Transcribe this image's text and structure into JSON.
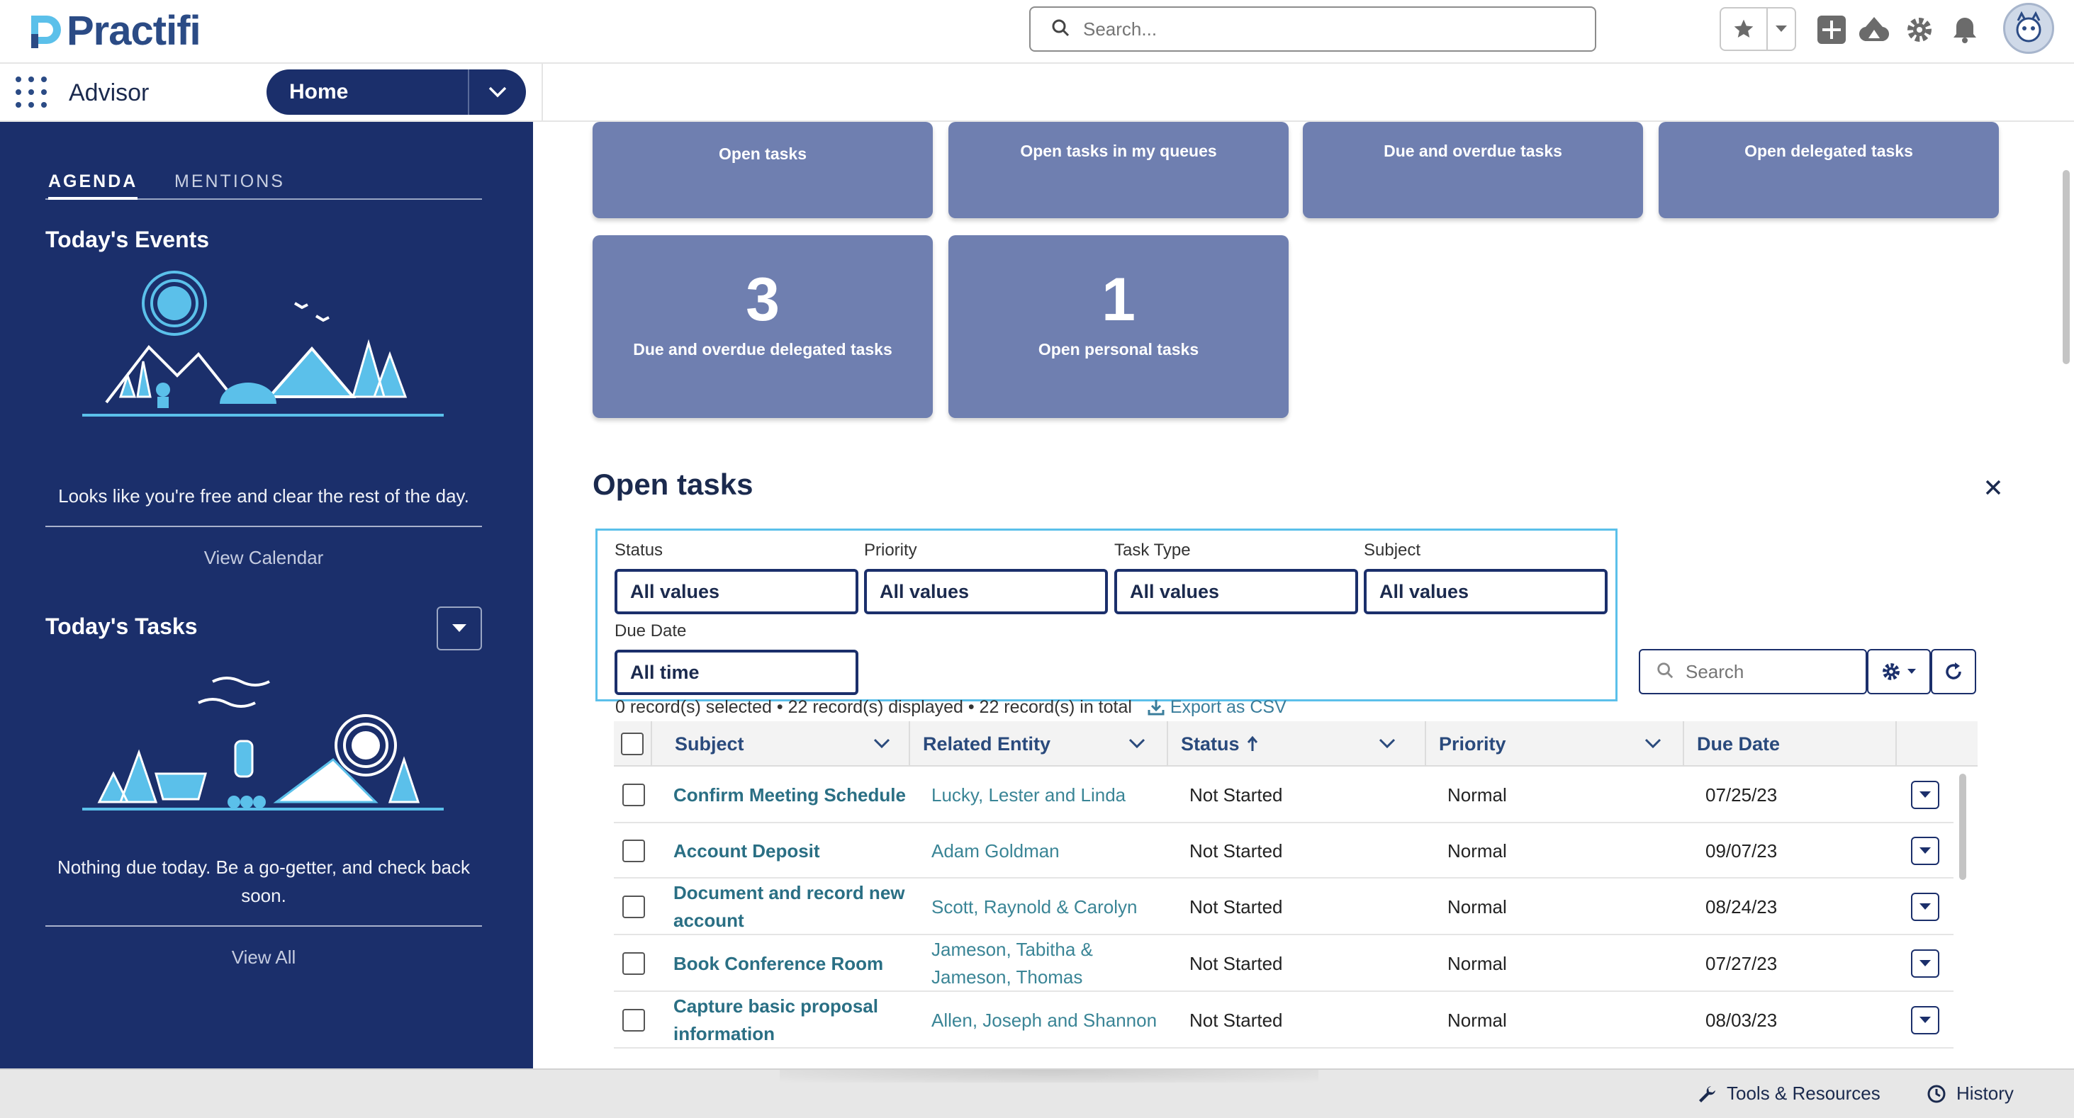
{
  "brand": {
    "logo_text": "Practifi",
    "accent": "#1b2f6b",
    "logo_color": "#2b4b85",
    "link_color": "#2a6f84"
  },
  "header": {
    "search_placeholder": "Search...",
    "icons": [
      "star-icon",
      "chevron-down-icon",
      "add-icon",
      "trailhead-icon",
      "gear-icon",
      "bell-icon",
      "avatar"
    ]
  },
  "nav": {
    "app_name": "Advisor",
    "tab_label": "Home"
  },
  "sidebar": {
    "tabs": [
      "AGENDA",
      "MENTIONS"
    ],
    "events_title": "Today's Events",
    "events_message": "Looks like you're free and clear the rest of the day.",
    "events_link": "View Calendar",
    "tasks_title": "Today's Tasks",
    "tasks_message": "Nothing due today. Be a go-getter, and check back soon.",
    "tasks_link": "View All"
  },
  "tiles": [
    {
      "label": "Open tasks",
      "count": ""
    },
    {
      "label": "Open tasks in my queues",
      "count": ""
    },
    {
      "label": "Due and overdue tasks",
      "count": ""
    },
    {
      "label": "Open delegated tasks",
      "count": ""
    },
    {
      "label": "Due and overdue delegated tasks",
      "count": "3"
    },
    {
      "label": "Open personal tasks",
      "count": "1"
    }
  ],
  "open_tasks": {
    "title": "Open tasks",
    "filters": {
      "status_label": "Status",
      "status_value": "All values",
      "priority_label": "Priority",
      "priority_value": "All values",
      "type_label": "Task Type",
      "type_value": "All values",
      "subject_label": "Subject",
      "subject_value": "All values",
      "due_label": "Due Date",
      "due_value": "All time"
    },
    "search_placeholder": "Search",
    "record_info": "0 record(s) selected • 22 record(s) displayed • 22 record(s) in total",
    "export_label": "Export as CSV",
    "columns": [
      "Subject",
      "Related Entity",
      "Status",
      "Priority",
      "Due Date"
    ],
    "rows": [
      {
        "subject": "Confirm Meeting Schedule",
        "related": "Lucky, Lester and Linda",
        "status": "Not Started",
        "priority": "Normal",
        "due": "07/25/23"
      },
      {
        "subject": "Account Deposit",
        "related": "Adam Goldman",
        "status": "Not Started",
        "priority": "Normal",
        "due": "09/07/23"
      },
      {
        "subject": "Document and record new account",
        "related": "Scott, Raynold & Carolyn",
        "status": "Not Started",
        "priority": "Normal",
        "due": "08/24/23"
      },
      {
        "subject": "Book Conference Room",
        "related": "Jameson, Tabitha & Jameson, Thomas",
        "status": "Not Started",
        "priority": "Normal",
        "due": "07/27/23"
      },
      {
        "subject": "Capture basic proposal information",
        "related": "Allen, Joseph and Shannon",
        "status": "Not Started",
        "priority": "Normal",
        "due": "08/03/23"
      }
    ]
  },
  "footer": {
    "tools_label": "Tools & Resources",
    "history_label": "History"
  }
}
